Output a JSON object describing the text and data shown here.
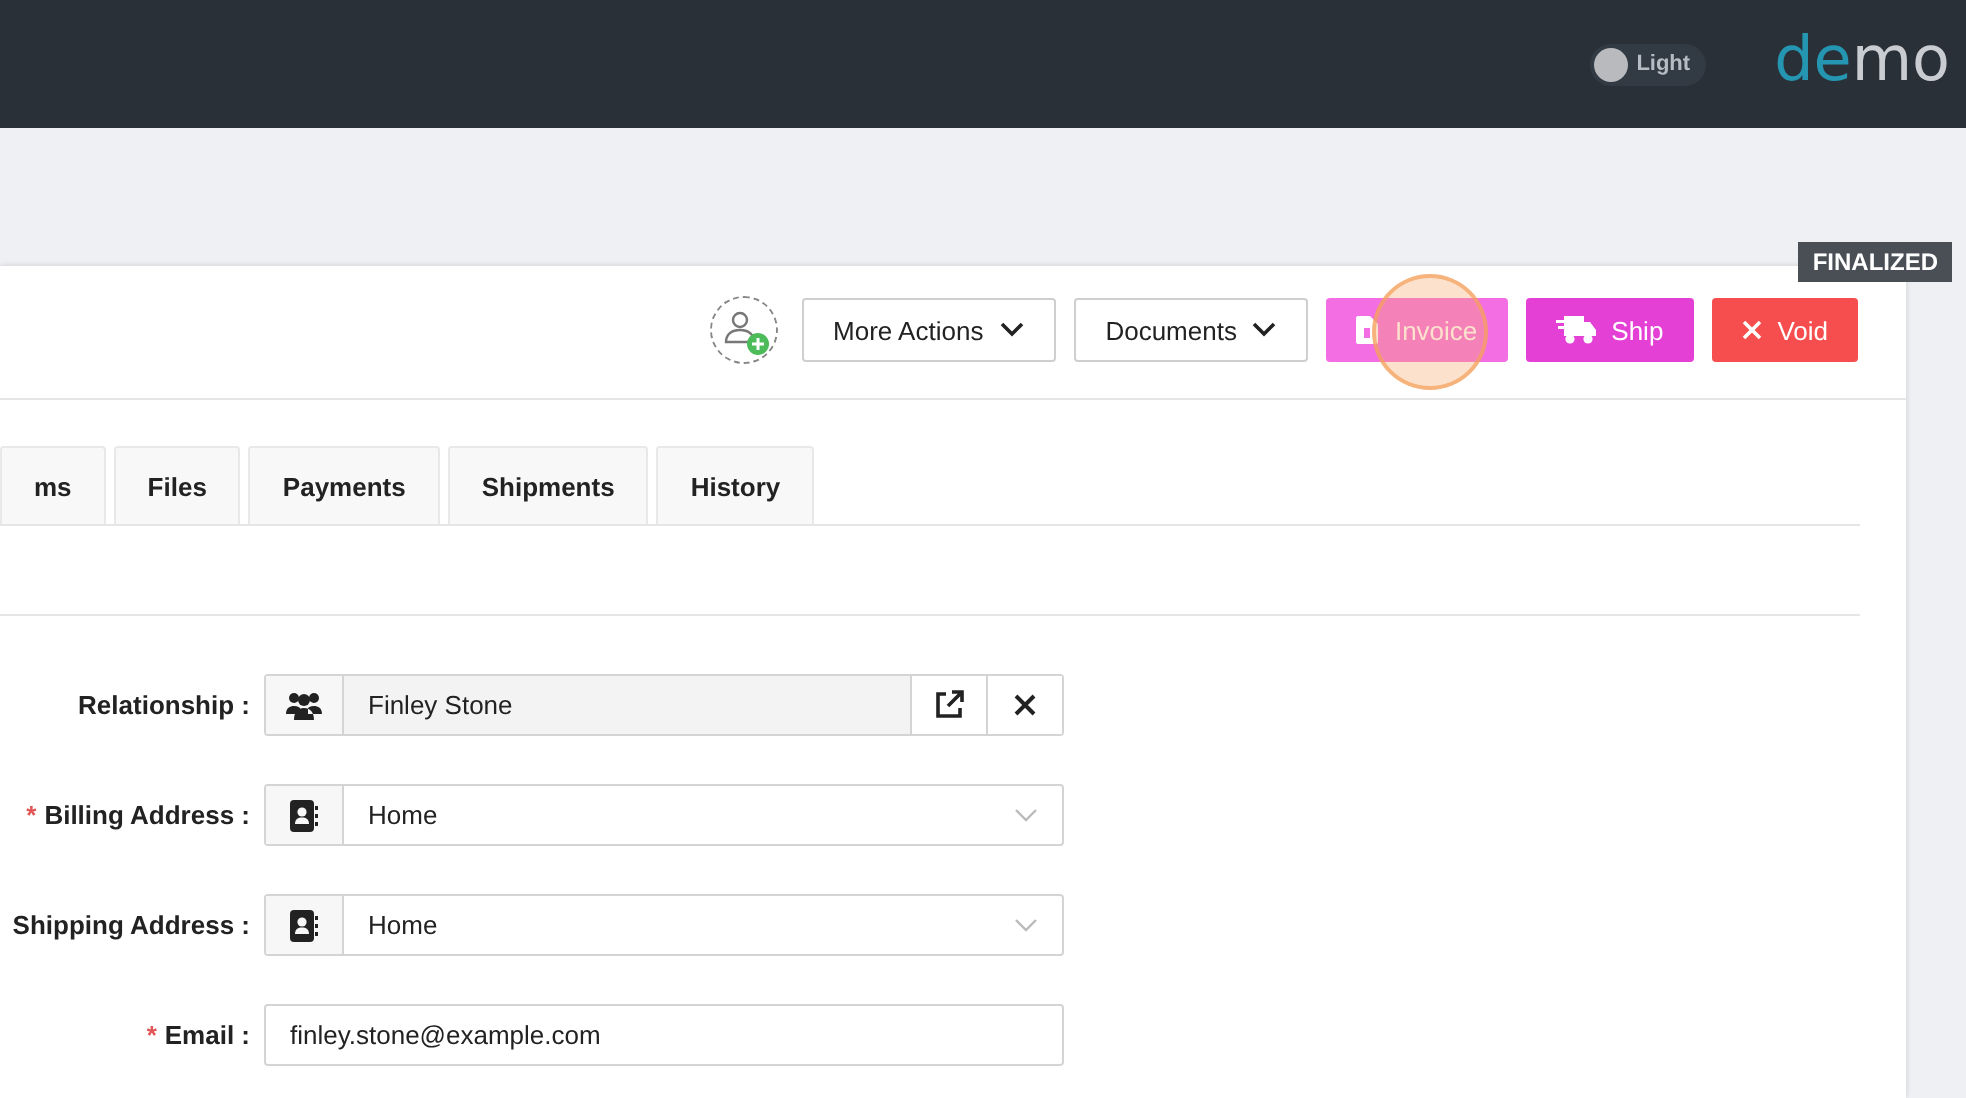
{
  "header": {
    "theme_toggle": {
      "label": "Light",
      "on": false
    },
    "logo": {
      "part_1": "de",
      "part_2": "mo"
    }
  },
  "status_badge": "FINALIZED",
  "actions": [
    {
      "kind": "assign"
    },
    {
      "kind": "dropdown",
      "label": "More Actions"
    },
    {
      "kind": "dropdown",
      "label": "Documents"
    },
    {
      "kind": "invoice",
      "label": "Invoice",
      "color": "#f36ee2",
      "highlighted": true
    },
    {
      "kind": "ship",
      "label": "Ship",
      "color": "#e440d5",
      "highlighted": false
    },
    {
      "kind": "void",
      "label": "Void",
      "color": "#f64e4e",
      "highlighted": false
    }
  ],
  "tabs": [
    {
      "label": "ms",
      "selected": false
    },
    {
      "label": "Files",
      "selected": false
    },
    {
      "label": "Payments",
      "selected": false
    },
    {
      "label": "Shipments",
      "selected": false
    },
    {
      "label": "History",
      "selected": false
    }
  ],
  "fields": [
    {
      "kind": "lookup",
      "label": "Relationship :",
      "value": "Finley Stone"
    },
    {
      "kind": "select",
      "required_mark": "*",
      "label": "Billing Address :",
      "value": "Home"
    },
    {
      "kind": "select",
      "label": "Shipping Address :",
      "value": "Home"
    },
    {
      "kind": "text",
      "required_mark": "*",
      "label": "Email :",
      "value": "finley.stone@example.com"
    }
  ]
}
